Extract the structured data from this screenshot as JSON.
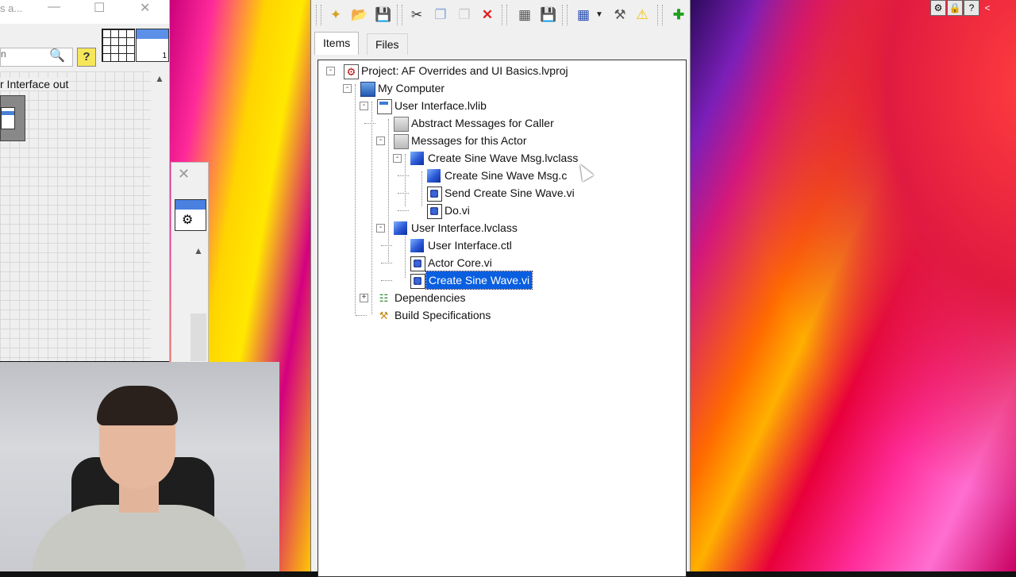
{
  "left_window": {
    "title_partial": "s a...",
    "search_partial": "n",
    "help_glyph": "?",
    "table_index": "1",
    "body_label": "r Interface out"
  },
  "project_window": {
    "tabs": [
      {
        "label": "Items",
        "active": true
      },
      {
        "label": "Files",
        "active": false
      }
    ],
    "toolbar": [
      "new-icon",
      "open-icon",
      "save-all-icon",
      "cut-icon",
      "copy-icon",
      "paste-icon",
      "delete-icon",
      "build-icon",
      "deploy-icon",
      "view-icon",
      "tools-icon",
      "warning-icon",
      "add-icon"
    ],
    "tree": [
      {
        "label": "Project: AF Overrides and UI Basics.lvproj",
        "icon": "project-icon",
        "expander": "-"
      },
      {
        "label": "My Computer",
        "icon": "computer-icon",
        "expander": "-"
      },
      {
        "label": "User Interface.lvlib",
        "icon": "library-icon",
        "expander": "-"
      },
      {
        "label": "Abstract Messages for Caller",
        "icon": "folder-icon",
        "expander": ""
      },
      {
        "label": "Messages for this Actor",
        "icon": "folder-icon",
        "expander": "-"
      },
      {
        "label": "Create Sine Wave Msg.lvclass",
        "icon": "class-icon",
        "expander": "-"
      },
      {
        "label": "Create Sine Wave Msg.c",
        "icon": "class-control-icon",
        "expander": ""
      },
      {
        "label": "Send Create Sine Wave.vi",
        "icon": "vi-icon",
        "expander": ""
      },
      {
        "label": "Do.vi",
        "icon": "vi-icon",
        "expander": ""
      },
      {
        "label": "User Interface.lvclass",
        "icon": "class-icon",
        "expander": "-"
      },
      {
        "label": "User Interface.ctl",
        "icon": "class-control-icon",
        "expander": ""
      },
      {
        "label": "Actor Core.vi",
        "icon": "vi-icon",
        "expander": ""
      },
      {
        "label": "Create Sine Wave.vi",
        "icon": "vi-icon",
        "expander": "",
        "selected": true
      },
      {
        "label": "Dependencies",
        "icon": "dependencies-icon",
        "expander": "+"
      },
      {
        "label": "Build Specifications",
        "icon": "build-spec-icon",
        "expander": ""
      }
    ]
  }
}
